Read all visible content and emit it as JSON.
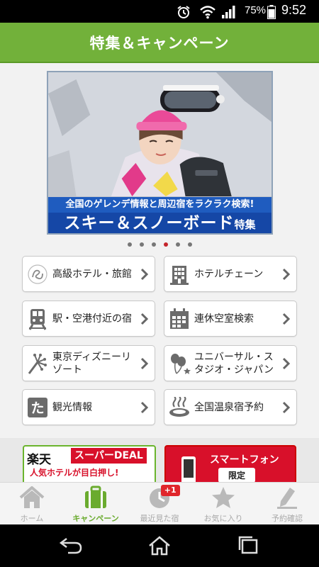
{
  "status_bar": {
    "battery_percent": "75%",
    "time": "9:52"
  },
  "header": {
    "title": "特集＆キャンペーン"
  },
  "banner": {
    "caption_top": "全国のゲレンデ情報と周辺宿をラクラク検索!",
    "caption_main": "スキー＆スノーボード",
    "caption_suffix": "特集"
  },
  "carousel": {
    "count": 6,
    "active_index": 3
  },
  "menu": [
    {
      "id": "luxury",
      "label": "高級ホテル・旅館",
      "icon": "luxury-logo-icon"
    },
    {
      "id": "chain",
      "label": "ホテルチェーン",
      "icon": "building-icon"
    },
    {
      "id": "station",
      "label": "駅・空港付近の宿",
      "icon": "train-icon"
    },
    {
      "id": "holiday",
      "label": "連休空室検索",
      "icon": "calendar-icon"
    },
    {
      "id": "disney",
      "label": "東京ディズニーリゾート",
      "icon": "fireworks-icon"
    },
    {
      "id": "universal",
      "label": "ユニバーサル・スタジオ・ジャパン",
      "icon": "balloon-icon"
    },
    {
      "id": "sightseeing",
      "label": "観光情報",
      "icon": "ta-character-icon"
    },
    {
      "id": "onsen",
      "label": "全国温泉宿予約",
      "icon": "hot-spring-icon"
    }
  ],
  "promos": {
    "rakuten": {
      "brand": "楽天",
      "deal": "スーパーDEAL",
      "sub": "人気ホテルが目白押し!"
    },
    "smartphone": {
      "title": "スマートフォン",
      "limited": "限定"
    }
  },
  "tabs": [
    {
      "id": "home",
      "label": "ホーム",
      "icon": "house-icon"
    },
    {
      "id": "campaign",
      "label": "キャンペーン",
      "icon": "suitcase-icon",
      "active": true
    },
    {
      "id": "recent",
      "label": "最近見た宿",
      "icon": "clock-icon",
      "badge": "+1"
    },
    {
      "id": "favorites",
      "label": "お気に入り",
      "icon": "star-icon"
    },
    {
      "id": "reservations",
      "label": "予約確認",
      "icon": "pen-icon"
    }
  ],
  "colors": {
    "accent": "#72b13a",
    "active_tab": "#6aab2e",
    "badge": "#e0262b",
    "dot_active": "#c4242b"
  }
}
